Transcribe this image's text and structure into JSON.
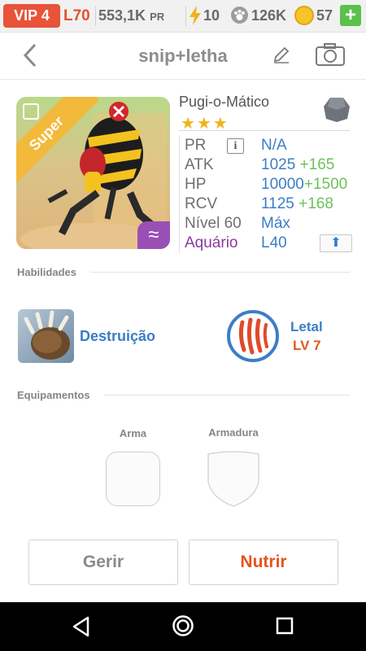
{
  "status": {
    "vip": "VIP 4",
    "level": "L70",
    "power": "553,1K",
    "power_unit": "PR",
    "energy": "10",
    "paws": "126K",
    "coins": "57",
    "add_label": "+"
  },
  "header": {
    "title": "snip+letha"
  },
  "monster": {
    "name": "Pugi-o-Mático",
    "rarity_label": "Super",
    "stars": "★★★",
    "element_symbol": "≈",
    "stats": [
      {
        "label": "PR",
        "value": "N/A",
        "bonus": ""
      },
      {
        "label": "ATK",
        "value": "1025",
        "bonus": "+165"
      },
      {
        "label": "HP",
        "value": "10000",
        "bonus": "+1500"
      },
      {
        "label": "RCV",
        "value": "1125",
        "bonus": "+168"
      },
      {
        "label": "Nível 60",
        "value": "Máx",
        "bonus": ""
      },
      {
        "label": "Aquário",
        "value": "L40",
        "bonus": ""
      }
    ],
    "info_symbol": "i",
    "upgrade_symbol": "⬆"
  },
  "abilities": {
    "section_title": "Habilidades",
    "primary": "Destruição",
    "secondary_name": "Letal",
    "secondary_level": "LV 7"
  },
  "equipment": {
    "section_title": "Equipamentos",
    "weapon_label": "Arma",
    "armor_label": "Armadura"
  },
  "actions": {
    "manage": "Gerir",
    "feed": "Nutrir"
  },
  "colors": {
    "accent_orange": "#e6531b",
    "value_blue": "#3b7ec6",
    "bonus_green": "#6cc15a",
    "aquarium_purple": "#8a3a9c",
    "star_gold": "#f0b21b"
  }
}
